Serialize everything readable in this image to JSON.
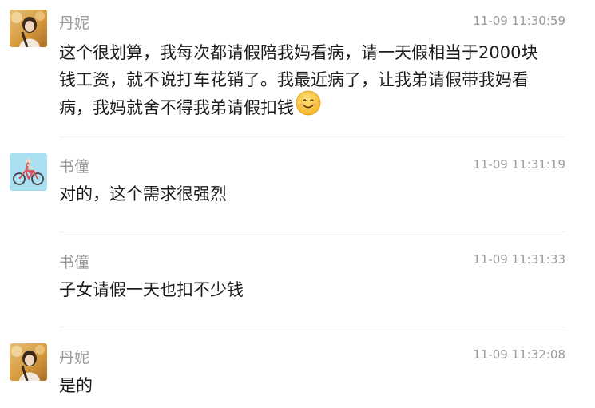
{
  "comments": [
    {
      "author": "丹妮",
      "time": "11-09 11:30:59",
      "line1": "这个很划算，我每次都请假陪我妈看病，请一天假相当于2000块",
      "line2": "钱工资，就不说打车花销了。我最近病了，让我弟请假带我妈看",
      "line3": "病，我妈就舍不得我弟请假扣钱",
      "emoji": "smiling-face-emoji",
      "avatar": "avatar-photo-icon"
    },
    {
      "author": "书僮",
      "time": "11-09 11:31:19",
      "text": "对的，这个需求很强烈",
      "avatar": "cyclist-icon"
    },
    {
      "author": "书僮",
      "time": "11-09 11:31:33",
      "text": "子女请假一天也扣不少钱"
    },
    {
      "author": "丹妮",
      "time": "11-09 11:32:08",
      "text": "是的",
      "avatar": "avatar-photo-icon"
    }
  ],
  "colors": {
    "name": "#9a9a9a",
    "text": "#1b1b1b",
    "divider": "#e9e9e9",
    "cyclist_bg": "#a9dff0"
  }
}
